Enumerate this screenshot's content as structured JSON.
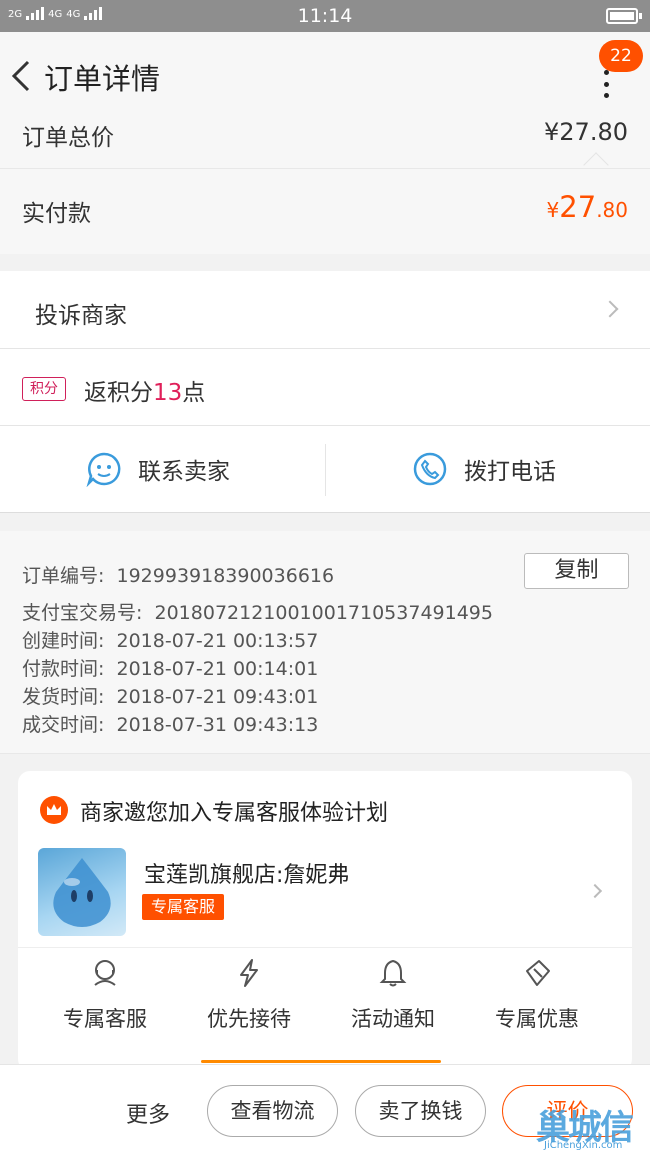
{
  "status_bar": {
    "signal_left": "2G",
    "signal_mid": "4G",
    "signal_mid2": "4G",
    "time": "11:14"
  },
  "nav": {
    "title": "订单详情",
    "badge_count": "22"
  },
  "price": {
    "total_label": "订单总价",
    "total_value": "¥27.80",
    "paid_label": "实付款",
    "paid_currency": "¥",
    "paid_int": "27",
    "paid_dec": ".80"
  },
  "complaint": {
    "label": "投诉商家"
  },
  "points": {
    "tag": "积分",
    "prefix": "返积分",
    "value": "13",
    "suffix": "点"
  },
  "contact": {
    "seller_label": "联系卖家",
    "phone_label": "拨打电话"
  },
  "order_info": {
    "order_no_label": "订单编号:",
    "order_no": "192993918390036616",
    "copy_label": "复制",
    "alipay_label": "支付宝交易号:",
    "alipay_no": "2018072121001001710537491495",
    "created_label": "创建时间:",
    "created": "2018-07-21 00:13:57",
    "paid_label": "付款时间:",
    "paid": "2018-07-21 00:14:01",
    "shipped_label": "发货时间:",
    "shipped": "2018-07-21 09:43:01",
    "completed_label": "成交时间:",
    "completed": "2018-07-31 09:43:13"
  },
  "service_card": {
    "title": "商家邀您加入专属客服体验计划",
    "shop_name": "宝莲凯旗舰店:詹妮弗",
    "tag": "专属客服",
    "features": [
      {
        "label": "专属客服",
        "icon": "headset-icon"
      },
      {
        "label": "优先接待",
        "icon": "lightning-icon"
      },
      {
        "label": "活动通知",
        "icon": "bell-icon"
      },
      {
        "label": "专属优惠",
        "icon": "ticket-icon"
      }
    ]
  },
  "bottom_bar": {
    "more": "更多",
    "logistics": "查看物流",
    "resell": "卖了换钱",
    "review": "评价"
  },
  "watermark": {
    "text_cn": "巢城信",
    "text_en": "JiChengXin.com"
  },
  "colors": {
    "accent": "#ff5000",
    "points": "#e0205a",
    "icon_blue": "#3a9bdc"
  }
}
